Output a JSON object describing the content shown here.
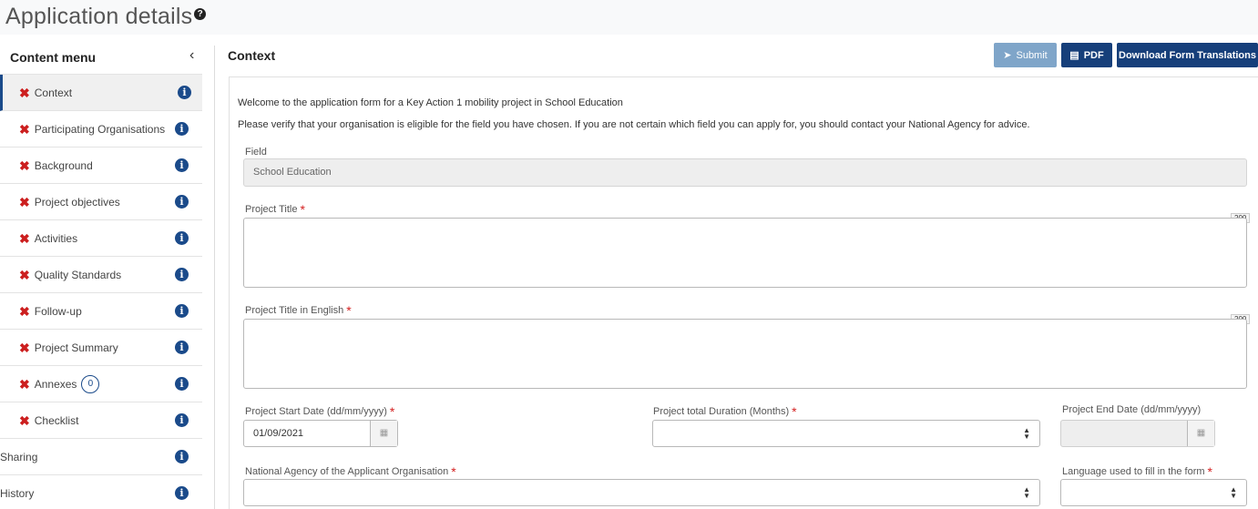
{
  "page": {
    "title": "Application details",
    "help_icon": "question-circle-icon"
  },
  "sidebar": {
    "title": "Content menu",
    "collapse_icon": "chevron-left-icon",
    "items": [
      {
        "label": "Context",
        "status": "incomplete",
        "active": true
      },
      {
        "label": "Participating Organisations",
        "status": "incomplete"
      },
      {
        "label": "Background",
        "status": "incomplete"
      },
      {
        "label": "Project objectives",
        "status": "incomplete"
      },
      {
        "label": "Activities",
        "status": "incomplete"
      },
      {
        "label": "Quality Standards",
        "status": "incomplete"
      },
      {
        "label": "Follow-up",
        "status": "incomplete"
      },
      {
        "label": "Project Summary",
        "status": "incomplete"
      },
      {
        "label": "Annexes",
        "status": "incomplete",
        "badge": "0"
      },
      {
        "label": "Checklist",
        "status": "incomplete"
      },
      {
        "label": "Sharing"
      },
      {
        "label": "History"
      }
    ]
  },
  "main": {
    "title": "Context",
    "toolbar": {
      "submit_label": "Submit",
      "pdf_label": "PDF",
      "download_label": "Download Form Translations"
    },
    "intro": "Welcome to the application form for a Key Action 1 mobility project in School Education",
    "notice": "Please verify that your organisation is eligible for the field you have chosen. If you are not certain which field you can apply for, you should contact your National Agency for advice.",
    "field_label": "Field",
    "field_value": "School Education",
    "project_title_label": "Project Title",
    "project_title_counter": "200",
    "project_title_en_label": "Project Title in English",
    "project_title_en_counter": "200",
    "start_date_label": "Project Start Date (dd/mm/yyyy)",
    "start_date_value": "01/09/2021",
    "duration_label": "Project total Duration (Months)",
    "end_date_label": "Project End Date (dd/mm/yyyy)",
    "national_agency_label": "National Agency of the Applicant Organisation",
    "language_label": "Language used to fill in the form",
    "required_mark": "*"
  },
  "colors": {
    "primary": "#163f7a",
    "submit_disabled": "#7fa5c9",
    "error": "#cc1f1f",
    "info": "#1a4a8a"
  }
}
